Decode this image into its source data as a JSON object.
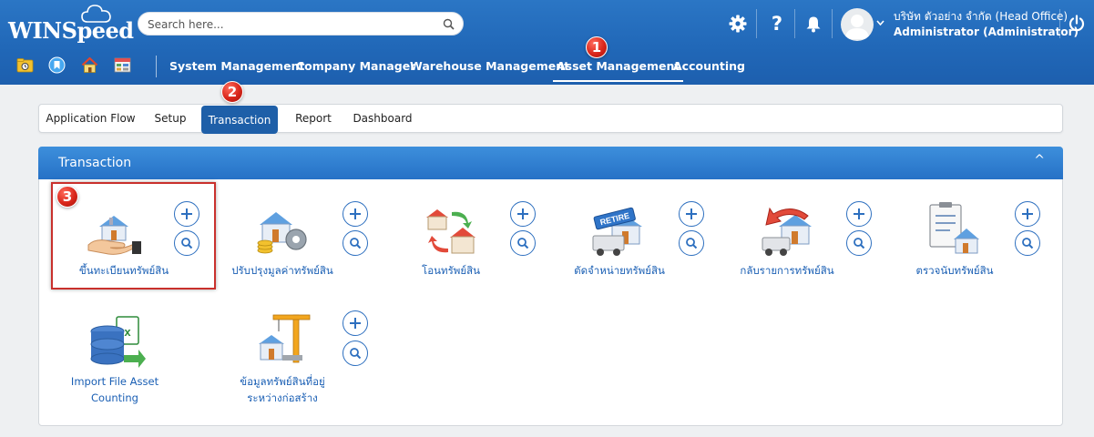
{
  "app": {
    "logo_text": "WINSpeed"
  },
  "search": {
    "placeholder": "Search here..."
  },
  "header_icons": [
    "gear-icon",
    "help-icon",
    "bell-icon",
    "power-icon"
  ],
  "user": {
    "company": "บริษัท ตัวอย่าง จำกัด (Head Office)",
    "role": "Administrator (Administrator)"
  },
  "quick_icons": [
    "folder-icon",
    "bookmark-icon",
    "home-icon",
    "grid-icon"
  ],
  "top_nav": [
    "System Management",
    "Company Manager",
    "Warehouse Management",
    "Asset Management",
    "Accounting"
  ],
  "sub_tabs": [
    "Application Flow",
    "Setup",
    "Transaction",
    "Report",
    "Dashboard"
  ],
  "step_badges": [
    "1",
    "2",
    "3"
  ],
  "panel": {
    "title": "Transaction",
    "collapse_glyph": "^"
  },
  "tiles": [
    {
      "label": "ขึ้นทะเบียนทรัพย์สิน",
      "icon": "asset-register-icon"
    },
    {
      "label": "ปรับปรุงมูลค่าทรัพย์สิน",
      "icon": "asset-revalue-icon"
    },
    {
      "label": "โอนทรัพย์สิน",
      "icon": "asset-transfer-icon"
    },
    {
      "label": "ตัดจำหน่ายทรัพย์สิน",
      "icon": "asset-retire-icon",
      "badge_text": "RETIRE"
    },
    {
      "label": "กลับรายการทรัพย์สิน",
      "icon": "asset-reverse-icon"
    },
    {
      "label": "ตรวจนับทรัพย์สิน",
      "icon": "asset-count-icon"
    },
    {
      "label_line1": "Import File Asset",
      "label_line2": "Counting",
      "icon": "import-excel-icon"
    },
    {
      "label_line1": "ข้อมูลทรัพย์สินที่อยู่",
      "label_line2": "ระหว่างก่อสร้าง",
      "icon": "construction-crane-icon"
    }
  ],
  "colors": {
    "header": "#2168b8",
    "active_tab": "#1e5fa8",
    "link": "#1a5fb4",
    "badge": "#d9261a",
    "highlight": "#c9302c"
  }
}
